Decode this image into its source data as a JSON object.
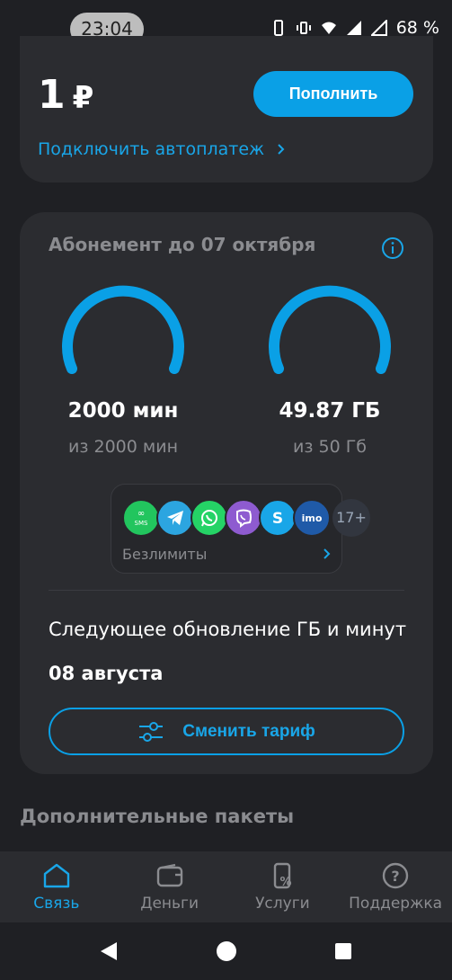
{
  "status_bar": {
    "time": "23:04",
    "battery": "68 %"
  },
  "balance_card": {
    "amount": "1",
    "currency": "₽",
    "topup_label": "Пополнить",
    "autopay_label": "Подключить автоплатеж"
  },
  "subscription": {
    "title": "Абонемент до 07 октября",
    "minutes": {
      "value": "2000 мин",
      "total": "из 2000 мин",
      "fraction": 1.0
    },
    "data": {
      "value": "49.87 ГБ",
      "total": "из 50 Гб",
      "fraction": 0.997
    },
    "unlimited": {
      "apps": [
        "sms",
        "telegram",
        "whatsapp",
        "viber",
        "skype",
        "imo"
      ],
      "app_labels": {
        "sms": "SMS",
        "imo": "imo"
      },
      "more": "17+",
      "label": "Безлимиты"
    },
    "next_update": {
      "text": "Следующее обновление ГБ и минут",
      "date": "08 августа"
    },
    "change_tariff_label": "Сменить тариф"
  },
  "additional_packages_title": "Дополнительные пакеты",
  "bottom_nav": [
    {
      "label": "Связь",
      "icon": "home-icon",
      "active": true
    },
    {
      "label": "Деньги",
      "icon": "wallet-icon",
      "active": false
    },
    {
      "label": "Услуги",
      "icon": "services-icon",
      "active": false
    },
    {
      "label": "Поддержка",
      "icon": "help-icon",
      "active": false
    }
  ],
  "colors": {
    "accent": "#0aa0e6",
    "background": "#1f2024",
    "card": "#2b2c30",
    "muted": "#8b8c90"
  }
}
